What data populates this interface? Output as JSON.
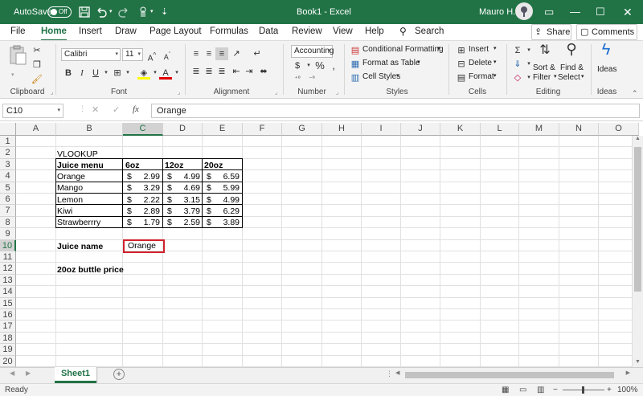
{
  "titlebar": {
    "autosave_label": "AutoSave",
    "autosave_state": "Off",
    "title": "Book1  -  Excel",
    "user_name": "Mauro H."
  },
  "tabs": [
    "File",
    "Home",
    "Insert",
    "Draw",
    "Page Layout",
    "Formulas",
    "Data",
    "Review",
    "View",
    "Help"
  ],
  "active_tab": "Home",
  "search_label": "Search",
  "share_label": "Share",
  "comments_label": "Comments",
  "ribbon": {
    "clipboard": "Clipboard",
    "font_group": "Font",
    "font_name": "Calibri",
    "font_size": "11",
    "alignment": "Alignment",
    "number_group": "Number",
    "number_format": "Accounting",
    "styles": "Styles",
    "conditional_formatting": "Conditional Formatting",
    "format_as_table": "Format as Table",
    "cell_styles": "Cell Styles",
    "cells": "Cells",
    "insert": "Insert",
    "delete": "Delete",
    "format": "Format",
    "editing": "Editing",
    "sort_filter_1": "Sort &",
    "sort_filter_2": "Filter",
    "find_select_1": "Find &",
    "find_select_2": "Select",
    "ideas_label": "Ideas",
    "ideas_group": "Ideas"
  },
  "formula_bar": {
    "name_box": "C10",
    "fx": "fx",
    "content": "Orange"
  },
  "columns": [
    "A",
    "B",
    "C",
    "D",
    "E",
    "F",
    "G",
    "H",
    "I",
    "J",
    "K",
    "L",
    "M",
    "N",
    "O"
  ],
  "rows": [
    "1",
    "2",
    "3",
    "4",
    "5",
    "6",
    "7",
    "8",
    "9",
    "10",
    "11",
    "12",
    "13",
    "14",
    "15",
    "16",
    "17",
    "18",
    "19",
    "20"
  ],
  "selected_cell": "C10",
  "sheet": {
    "title": "VLOOKUP",
    "headers": [
      "Juice menu",
      "6oz",
      "12oz",
      "20oz"
    ],
    "rows": [
      {
        "name": "Orange",
        "p6": "2.99",
        "p12": "4.99",
        "p20": "6.59"
      },
      {
        "name": "Mango",
        "p6": "3.29",
        "p12": "4.69",
        "p20": "5.99"
      },
      {
        "name": "Lemon",
        "p6": "2.22",
        "p12": "3.15",
        "p20": "4.99"
      },
      {
        "name": "Kiwi",
        "p6": "2.89",
        "p12": "3.79",
        "p20": "6.29"
      },
      {
        "name": "Strawberrry",
        "p6": "1.79",
        "p12": "2.59",
        "p20": "3.89"
      }
    ],
    "currency": "$",
    "juice_name_label": "Juice name",
    "juice_name_value": "Orange",
    "price_label": "20oz buttle price"
  },
  "sheet_tabs": [
    "Sheet1"
  ],
  "status": {
    "ready": "Ready",
    "zoom": "100%"
  },
  "colors": {
    "accent": "#217346",
    "selection_border": "#d0222c"
  }
}
